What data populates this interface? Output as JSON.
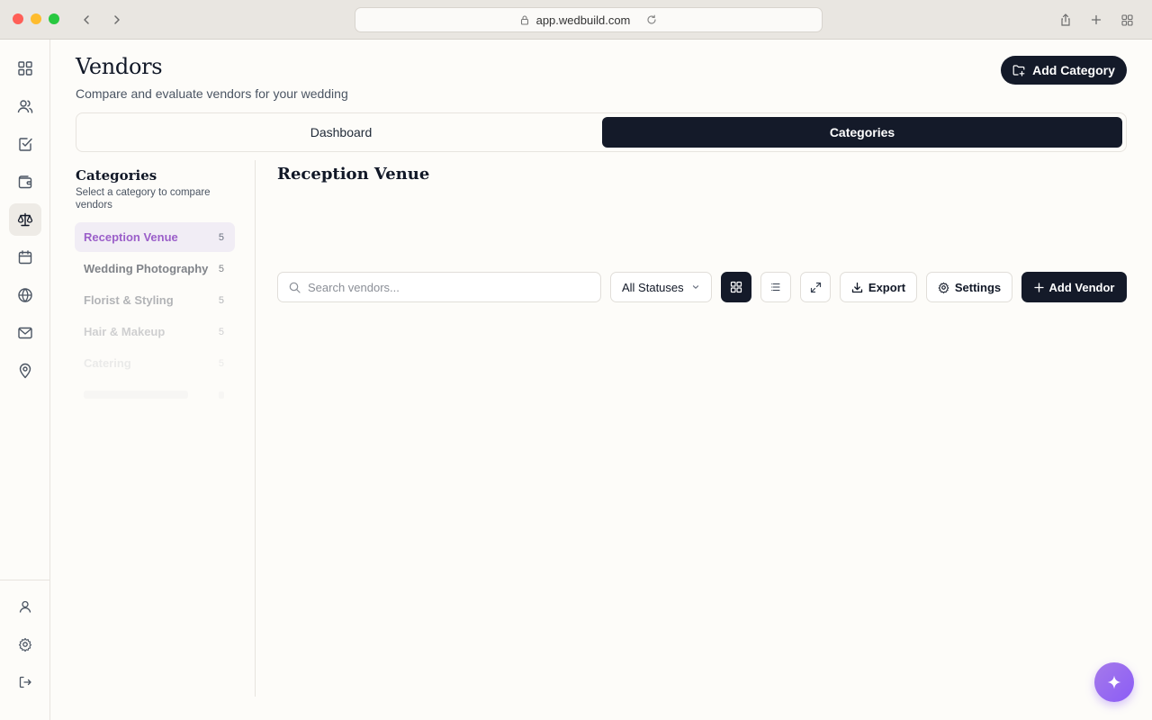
{
  "browser": {
    "url": "app.wedbuild.com"
  },
  "header": {
    "title": "Vendors",
    "subtitle": "Compare and evaluate vendors for your wedding",
    "add_category_label": "Add Category"
  },
  "tabs": [
    {
      "label": "Dashboard",
      "active": false
    },
    {
      "label": "Categories",
      "active": true
    }
  ],
  "categories_panel": {
    "heading": "Categories",
    "description": "Select a category to compare vendors",
    "items": [
      {
        "label": "Reception Venue",
        "count": "5",
        "active": true
      },
      {
        "label": "Wedding Photography",
        "count": "5",
        "active": false
      },
      {
        "label": "Florist & Styling",
        "count": "5",
        "active": false
      },
      {
        "label": "Hair & Makeup",
        "count": "5",
        "active": false
      },
      {
        "label": "Catering",
        "count": "5",
        "active": false
      }
    ]
  },
  "main": {
    "section_title": "Reception Venue",
    "search_placeholder": "Search vendors...",
    "status_filter": "All Statuses",
    "export_label": "Export",
    "settings_label": "Settings",
    "add_vendor_label": "Add Vendor",
    "view_mode": "grid"
  },
  "rail": {
    "top_icons": [
      "grid-icon",
      "users-icon",
      "checklist-icon",
      "wallet-icon",
      "scale-icon",
      "calendar-icon",
      "globe-icon",
      "mail-icon",
      "map-pin-icon"
    ],
    "active_icon": "scale-icon",
    "bottom_icons": [
      "user-icon",
      "gear-icon",
      "logout-icon"
    ]
  },
  "colors": {
    "accent": "#9b5fc9",
    "dark": "#141a29",
    "fab": "#8b5cf6"
  }
}
